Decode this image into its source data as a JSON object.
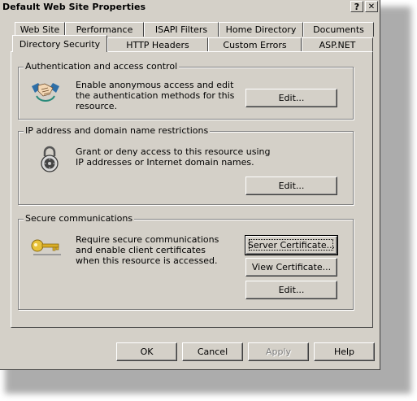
{
  "window": {
    "title": "Default Web Site Properties",
    "help_label": "?",
    "close_label": "✕"
  },
  "tabs_back": [
    "Web Site",
    "Performance",
    "ISAPI Filters",
    "Home Directory",
    "Documents"
  ],
  "tabs_front": [
    "Directory Security",
    "HTTP Headers",
    "Custom Errors",
    "ASP.NET"
  ],
  "active_tab": "Directory Security",
  "groups": {
    "auth": {
      "legend": "Authentication and access control",
      "text": "Enable anonymous access and edit the authentication methods for this resource.",
      "button": "Edit...",
      "icon": "handshake-icon"
    },
    "ip": {
      "legend": "IP address and domain name restrictions",
      "text": "Grant or deny access to this resource using IP addresses or Internet domain names.",
      "button": "Edit...",
      "icon": "padlock-icon"
    },
    "secure": {
      "legend": "Secure communications",
      "text": "Require secure communications and enable client certificates when this resource is accessed.",
      "server_cert_button": "Server Certificate...",
      "view_cert_button": "View Certificate...",
      "edit_button": "Edit...",
      "icon": "key-icon"
    }
  },
  "footer": {
    "ok": "OK",
    "cancel": "Cancel",
    "apply": "Apply",
    "help": "Help"
  },
  "colors": {
    "face": "#d4d0c8",
    "shadow": "#808080",
    "dark_shadow": "#404040",
    "highlight": "#ffffff",
    "disabled_text": "#808080"
  }
}
